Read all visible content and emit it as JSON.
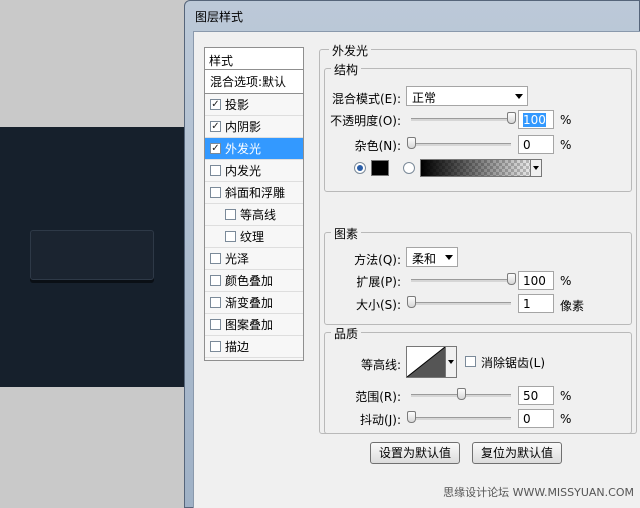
{
  "window": {
    "title": "图层样式"
  },
  "styles_list": {
    "header": "样式",
    "blend_options": "混合选项:默认",
    "items": [
      {
        "label": "投影",
        "checked": true,
        "selected": false,
        "indent": false
      },
      {
        "label": "内阴影",
        "checked": true,
        "selected": false,
        "indent": false
      },
      {
        "label": "外发光",
        "checked": true,
        "selected": true,
        "indent": false
      },
      {
        "label": "内发光",
        "checked": false,
        "selected": false,
        "indent": false
      },
      {
        "label": "斜面和浮雕",
        "checked": false,
        "selected": false,
        "indent": false
      },
      {
        "label": "等高线",
        "checked": false,
        "selected": false,
        "indent": true
      },
      {
        "label": "纹理",
        "checked": false,
        "selected": false,
        "indent": true
      },
      {
        "label": "光泽",
        "checked": false,
        "selected": false,
        "indent": false
      },
      {
        "label": "颜色叠加",
        "checked": false,
        "selected": false,
        "indent": false
      },
      {
        "label": "渐变叠加",
        "checked": false,
        "selected": false,
        "indent": false
      },
      {
        "label": "图案叠加",
        "checked": false,
        "selected": false,
        "indent": false
      },
      {
        "label": "描边",
        "checked": false,
        "selected": false,
        "indent": false
      }
    ]
  },
  "outer_glow": {
    "title": "外发光",
    "structure": {
      "title": "结构",
      "blend_mode_label": "混合模式(E):",
      "blend_mode_value": "正常",
      "opacity_label": "不透明度(O):",
      "opacity_value": "100",
      "opacity_level": 1.0,
      "noise_label": "杂色(N):",
      "noise_value": "0",
      "noise_level": 0.0,
      "percent": "%"
    },
    "elements": {
      "title": "图素",
      "technique_label": "方法(Q):",
      "technique_value": "柔和",
      "spread_label": "扩展(P):",
      "spread_value": "100",
      "spread_level": 1.0,
      "size_label": "大小(S):",
      "size_value": "1",
      "size_level": 0.0,
      "size_unit": "像素",
      "percent": "%"
    },
    "quality": {
      "title": "品质",
      "contour_label": "等高线:",
      "antialias_label": "消除锯齿(L)",
      "antialias_checked": false,
      "range_label": "范围(R):",
      "range_value": "50",
      "range_level": 0.5,
      "jitter_label": "抖动(J):",
      "jitter_value": "0",
      "jitter_level": 0.0,
      "percent": "%"
    },
    "buttons": {
      "set_default": "设置为默认值",
      "reset_default": "复位为默认值"
    }
  },
  "watermark": "思缘设计论坛 WWW.MISSYUAN.COM",
  "colors": {
    "accent": "#3399ff",
    "canvas_dark": "#16202c"
  }
}
